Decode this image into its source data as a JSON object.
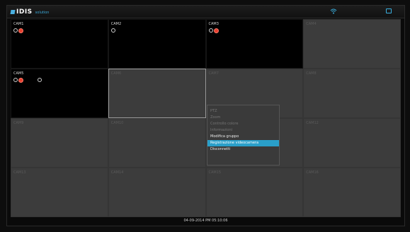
{
  "app": {
    "logo_text": "IDIS",
    "logo_sub": "solution"
  },
  "grid": {
    "cells": [
      {
        "label": "CAM1",
        "live": true,
        "icons": true
      },
      {
        "label": "CAM2",
        "live": true,
        "icons": "clock"
      },
      {
        "label": "CAM3",
        "live": true,
        "icons": true
      },
      {
        "label": "CAM4",
        "live": false
      },
      {
        "label": "CAM5",
        "live": true,
        "icons": "audio"
      },
      {
        "label": "CAM6",
        "live": false,
        "selected": true
      },
      {
        "label": "CAM7",
        "live": false
      },
      {
        "label": "CAM8",
        "live": false
      },
      {
        "label": "CAM9",
        "live": false
      },
      {
        "label": "CAM10",
        "live": false
      },
      {
        "label": "CAM11",
        "live": false
      },
      {
        "label": "CAM12",
        "live": false
      },
      {
        "label": "CAM13",
        "live": false
      },
      {
        "label": "CAM14",
        "live": false
      },
      {
        "label": "CAM15",
        "live": false
      },
      {
        "label": "CAM16",
        "live": false
      }
    ]
  },
  "context_menu": {
    "items": [
      {
        "label": "PTZ",
        "state": "disabled"
      },
      {
        "label": "Zoom",
        "state": "disabled"
      },
      {
        "label": "Controllo colore",
        "state": "disabled"
      },
      {
        "label": "Informazioni",
        "state": "disabled"
      },
      {
        "label": "Modifica gruppo",
        "state": "enabled"
      },
      {
        "label": "Registrazione videocamera",
        "state": "highlight"
      },
      {
        "label": "Disconnetti",
        "state": "enabled"
      }
    ]
  },
  "status": {
    "datetime": "04-09-2014 PM 05:10:06"
  },
  "colors": {
    "accent": "#2a9fc9",
    "record": "#e8402f"
  }
}
